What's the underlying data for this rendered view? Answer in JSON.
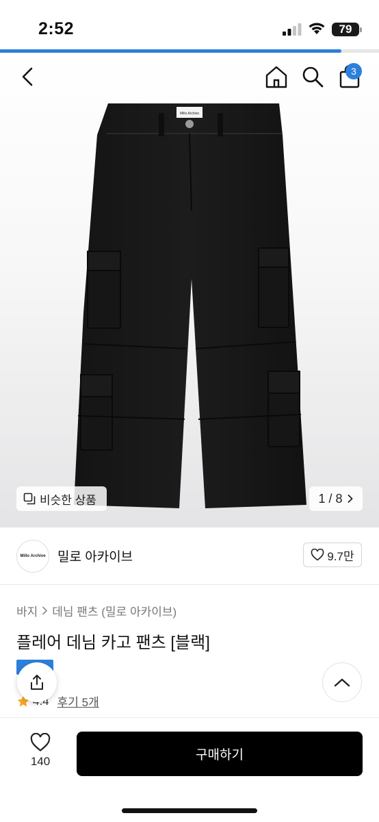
{
  "status_bar": {
    "time": "2:52",
    "battery": "79"
  },
  "page_progress": 0.9,
  "header": {
    "back_icon": "chevron-left-icon",
    "home_icon": "home-icon",
    "search_icon": "search-icon",
    "cart_icon": "shopping-bag-icon",
    "cart_badge": "3"
  },
  "gallery": {
    "logo_tag": "Millo Archive",
    "similar_label": "비슷한 상품",
    "pager": "1 / 8"
  },
  "shop": {
    "logo_text": "Millo Archive",
    "name": "밀로 아카이브",
    "likes": "9.7만"
  },
  "product": {
    "breadcrumb": [
      "바지",
      "데님 팬츠 (밀로 아카이브)"
    ],
    "title": "플레어 데님 카고 팬츠 [블랙]",
    "rating": "4.4",
    "reviews": "후기 5개"
  },
  "bottom_bar": {
    "wish_count": "140",
    "buy_label": "구매하기"
  },
  "colors": {
    "accent": "#2d7fdc",
    "buy_button": "#000000",
    "star": "#f5a623"
  }
}
